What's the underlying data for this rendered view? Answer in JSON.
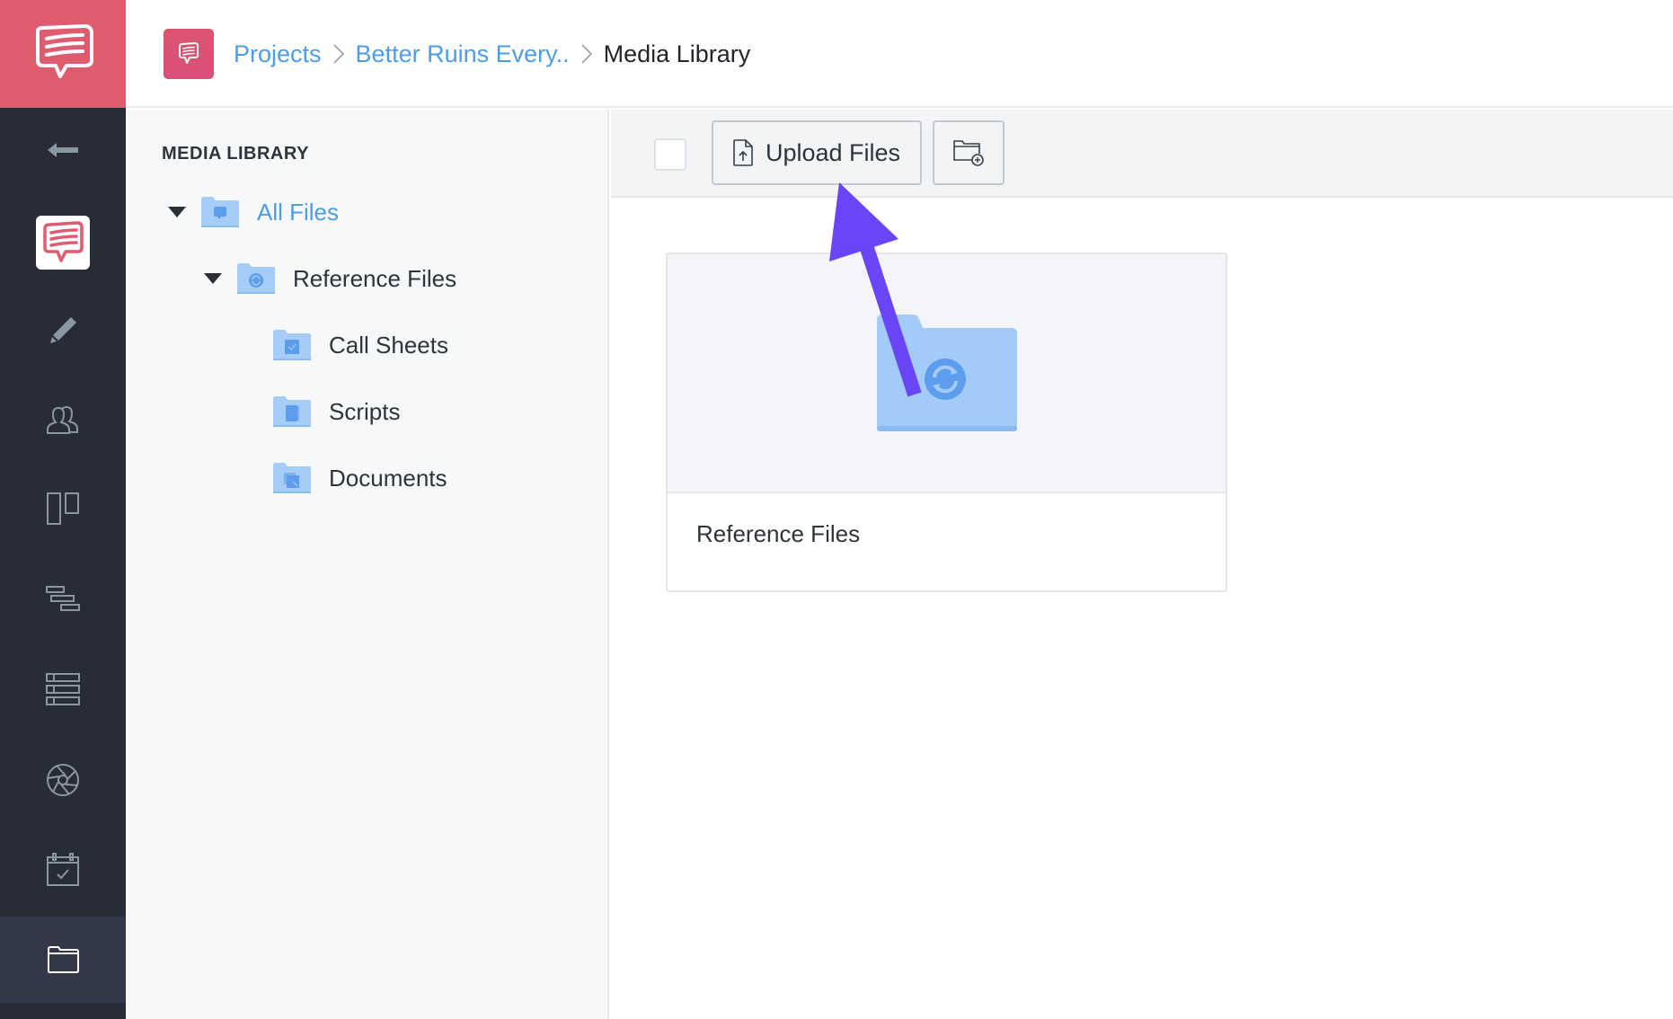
{
  "app": {
    "brand_icon": "speech-bubble-logo-icon",
    "accent_color": "#df5b70",
    "link_color": "#4d9ce8",
    "annotation_color": "#6a45f5"
  },
  "leftnav": {
    "items": [
      {
        "name": "back",
        "icon": "arrow-left-icon",
        "active": false
      },
      {
        "name": "project-overview",
        "icon": "project-logo-icon",
        "active": false
      },
      {
        "name": "edit",
        "icon": "pencil-icon",
        "active": false
      },
      {
        "name": "team",
        "icon": "users-icon",
        "active": false
      },
      {
        "name": "board",
        "icon": "board-icon",
        "active": false
      },
      {
        "name": "timeline",
        "icon": "gantt-icon",
        "active": false
      },
      {
        "name": "list",
        "icon": "list-icon",
        "active": false
      },
      {
        "name": "shots",
        "icon": "aperture-icon",
        "active": false
      },
      {
        "name": "calendar",
        "icon": "calendar-check-icon",
        "active": false
      },
      {
        "name": "files",
        "icon": "folder-icon",
        "active": true
      }
    ]
  },
  "header": {
    "breadcrumb": [
      {
        "label": "Projects",
        "link": true
      },
      {
        "label": "Better Ruins Every..",
        "link": true
      },
      {
        "label": "Media Library",
        "link": false
      }
    ]
  },
  "tree": {
    "title": "MEDIA LIBRARY",
    "items": [
      {
        "label": "All Files",
        "level": 0,
        "expanded": true,
        "selected": true,
        "icon": "speech-bubble-icon"
      },
      {
        "label": "Reference Files",
        "level": 1,
        "expanded": true,
        "selected": false,
        "icon": "sync-icon"
      },
      {
        "label": "Call Sheets",
        "level": 2,
        "expanded": false,
        "selected": false,
        "icon": "calendar-check-icon"
      },
      {
        "label": "Scripts",
        "level": 2,
        "expanded": false,
        "selected": false,
        "icon": "script-icon"
      },
      {
        "label": "Documents",
        "level": 2,
        "expanded": false,
        "selected": false,
        "icon": "documents-icon"
      }
    ]
  },
  "toolbar": {
    "select_all_checked": false,
    "upload_label": "Upload Files",
    "upload_icon": "file-upload-icon",
    "new_folder_icon": "folder-add-icon"
  },
  "content": {
    "folders": [
      {
        "name": "Reference Files",
        "icon": "sync-icon"
      }
    ]
  }
}
